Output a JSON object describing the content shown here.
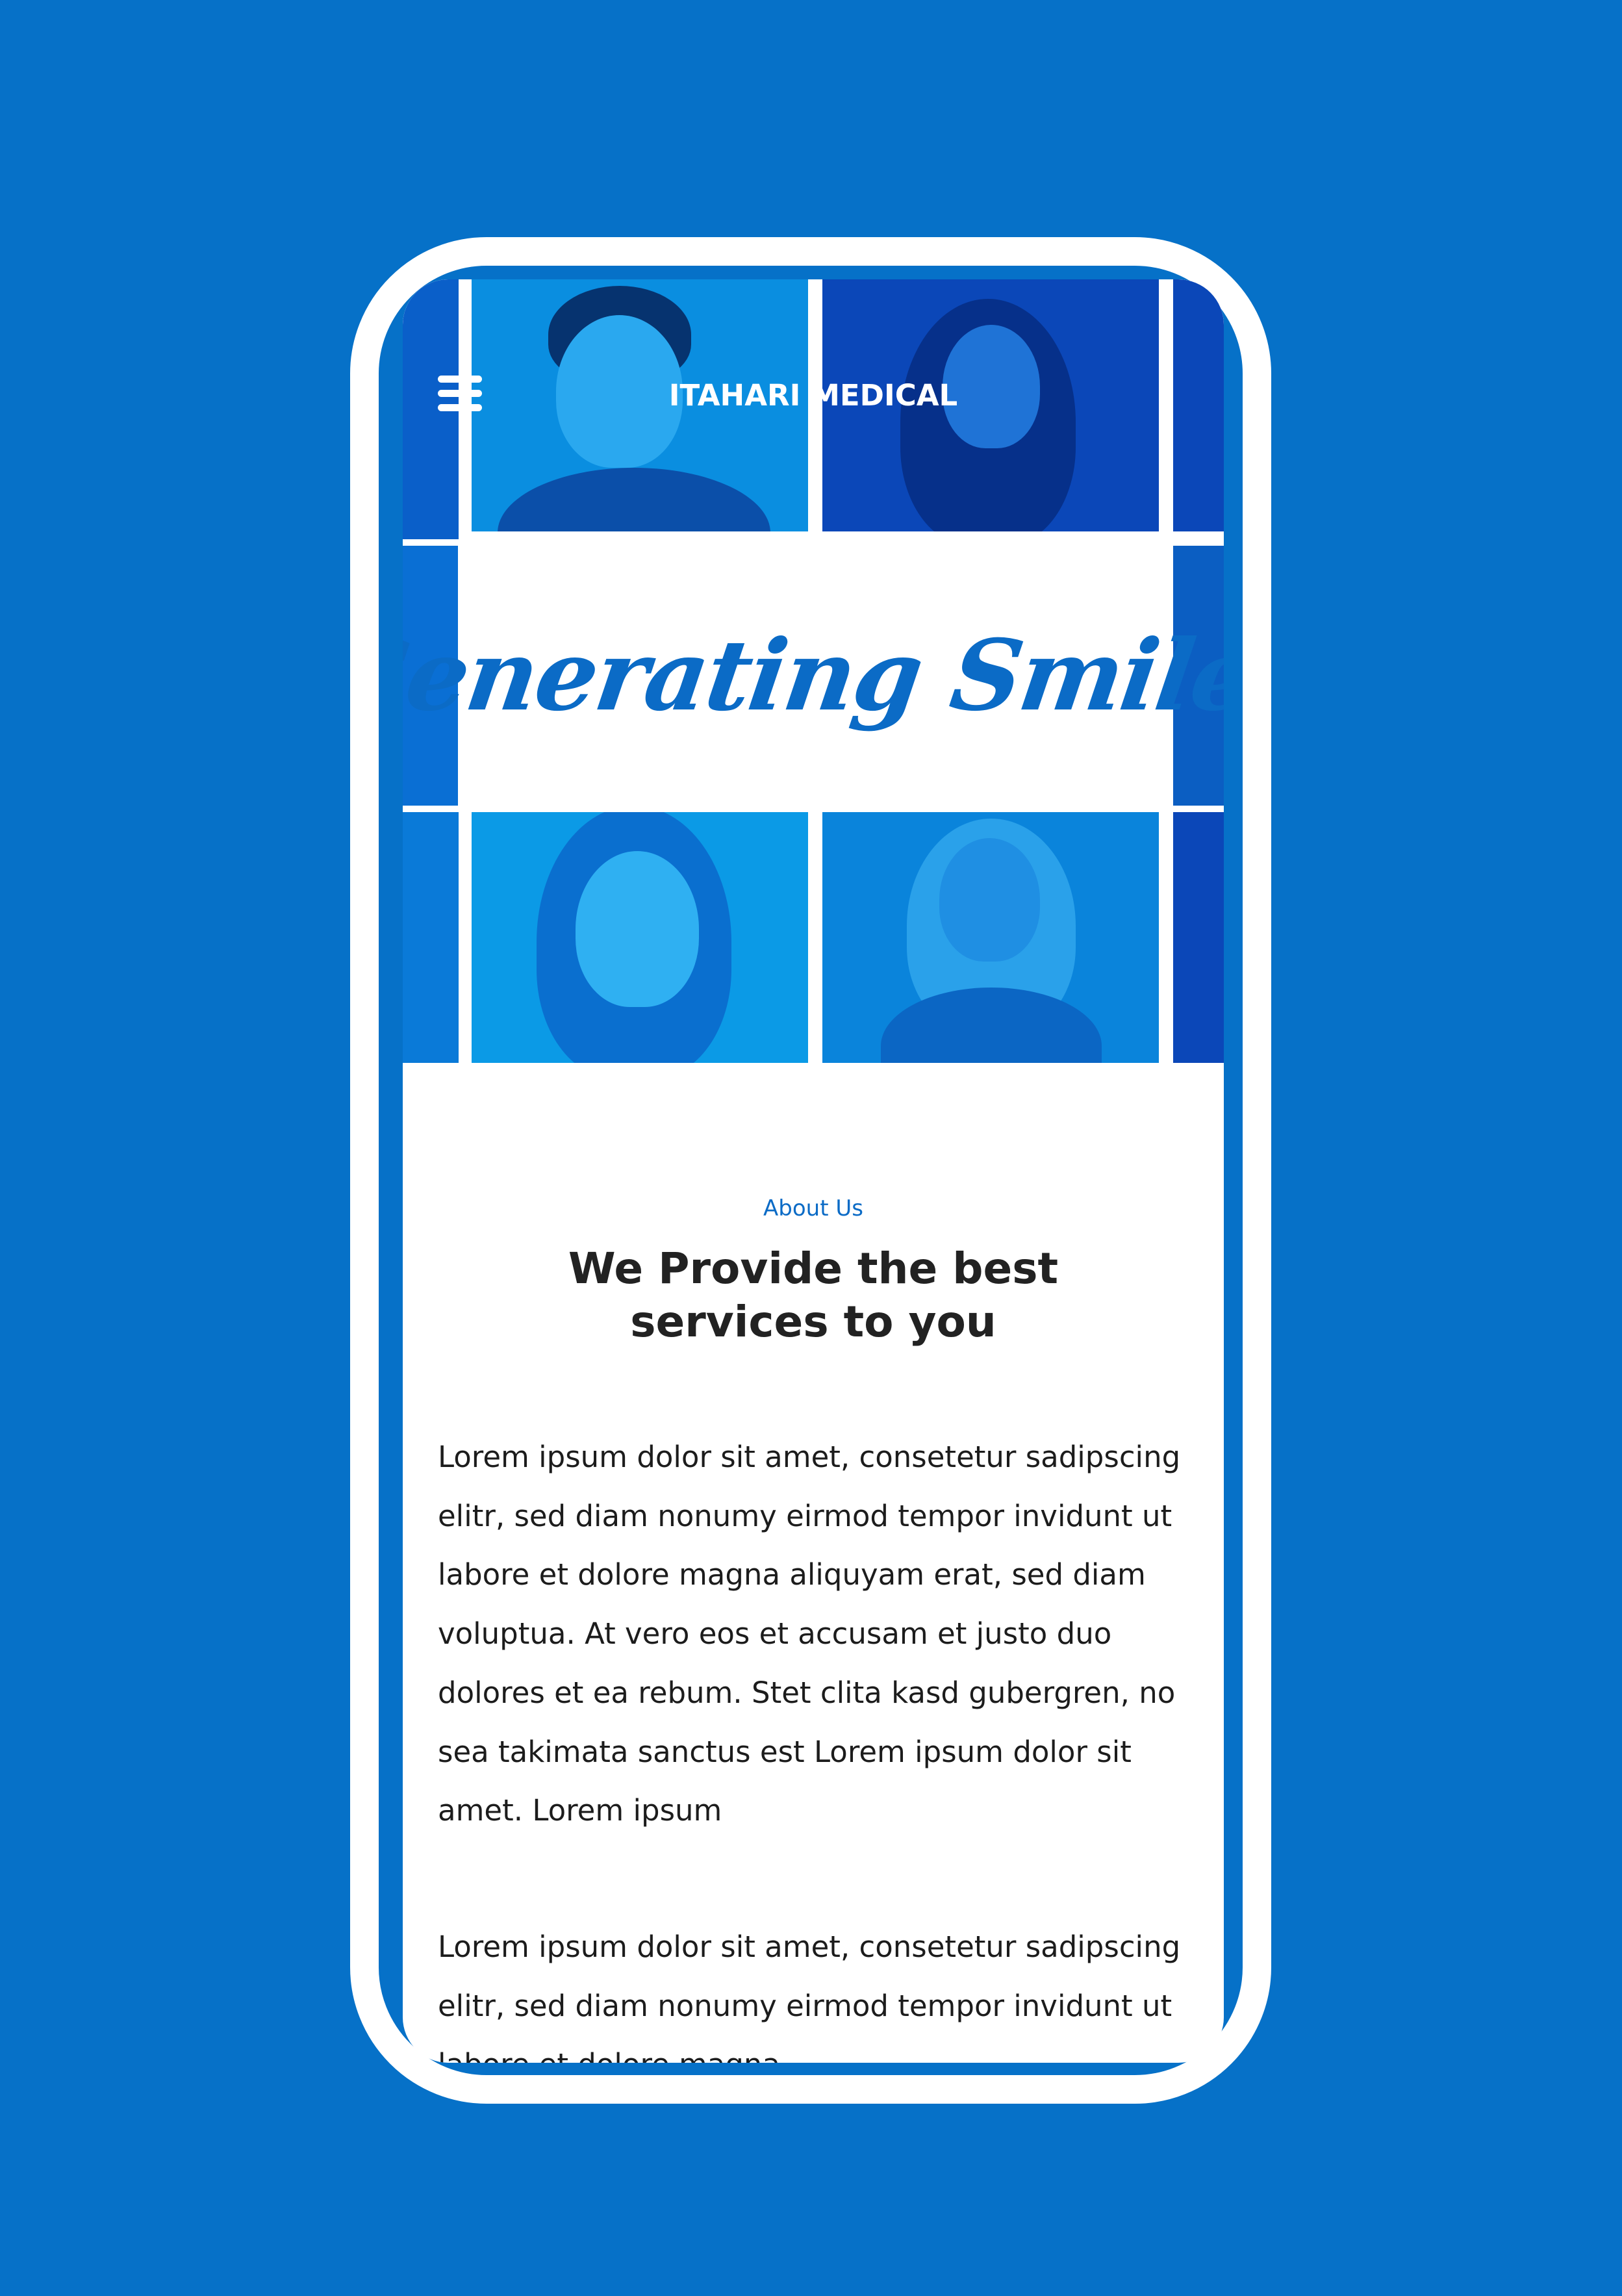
{
  "header": {
    "menu_icon": "hamburger-menu-icon",
    "brand": "ITAHARI MEDICAL"
  },
  "hero": {
    "title": "Generating Smiles"
  },
  "about": {
    "eyebrow": "About Us",
    "heading": "We Provide the best services to you",
    "paragraphs": [
      "Lorem ipsum dolor sit amet, consetetur sadipscing elitr, sed diam nonumy eirmod tempor invidunt ut labore et dolore magna aliquyam erat, sed diam voluptua. At vero eos et accusam et justo duo dolores et ea rebum. Stet clita kasd gubergren, no sea takimata sanctus est Lorem ipsum dolor sit amet. Lorem ipsum",
      "Lorem ipsum dolor sit amet, consetetur sadipscing elitr, sed diam nonumy eirmod tempor invidunt ut labore et dolore magna"
    ]
  },
  "colors": {
    "background": "#0671c8",
    "accent": "#0b6bc6",
    "photo_tint_light": "#0a8ee0",
    "photo_tint_dark": "#0b47b8"
  }
}
